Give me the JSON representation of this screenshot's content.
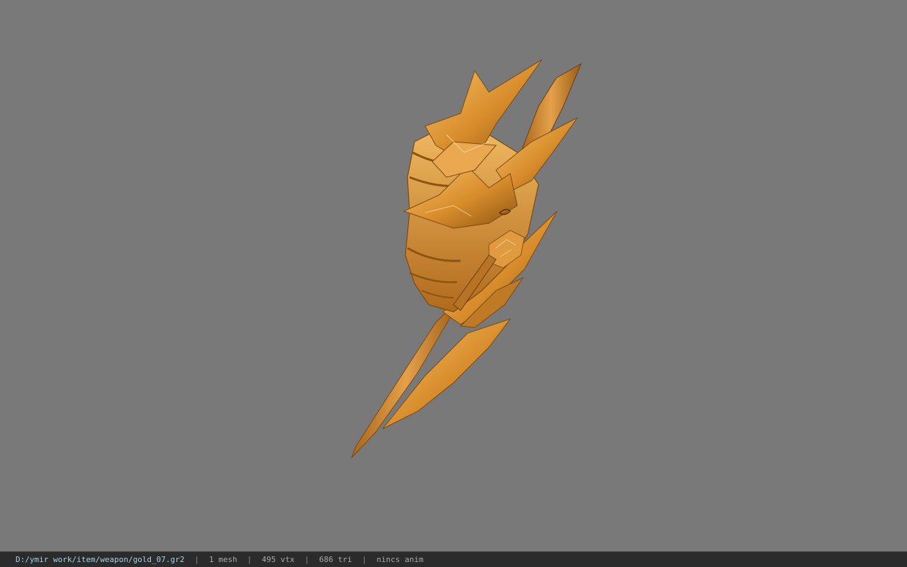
{
  "viewer": {
    "background_color": "#797979",
    "model_name": "gold_07",
    "model_colors": {
      "highlight": "#f4b55a",
      "base": "#d68a2a",
      "shadow": "#8a5412"
    }
  },
  "status": {
    "path": "D:/ymir work/item/weapon/gold_07.gr2",
    "sep": "|",
    "meshes": "1 mesh",
    "vertices": "495 vtx",
    "triangles": "686 tri",
    "anim": "nincs anim"
  }
}
